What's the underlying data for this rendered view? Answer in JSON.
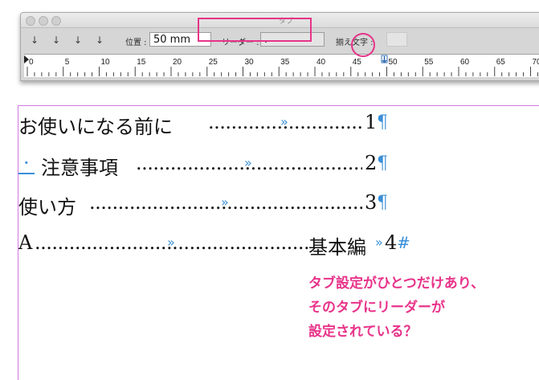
{
  "window": {
    "title": "タブ"
  },
  "toolbar": {
    "tab_types": [
      {
        "icon": "left-justified-tab-icon",
        "glyph": "↓"
      },
      {
        "icon": "center-justified-tab-icon",
        "glyph": "↓"
      },
      {
        "icon": "right-justified-tab-icon",
        "glyph": "↓"
      },
      {
        "icon": "align-to-decimal-tab-icon",
        "glyph": "↓"
      }
    ],
    "position_label": "位置 :",
    "position_value": "50 mm",
    "leader_label": "リーダー :",
    "leader_value": ".",
    "align_on_label": "揃え文字 :",
    "align_on_value": ""
  },
  "ruler": {
    "labels": [
      "0",
      "5",
      "10",
      "15",
      "20",
      "25",
      "30",
      "35",
      "40",
      "45",
      "50",
      "55",
      "60",
      "65",
      "70"
    ]
  },
  "document": {
    "lines": [
      {
        "text": "お使いになる前に",
        "number": "1",
        "end_mark": "¶"
      },
      {
        "text": "注意事項",
        "number": "2",
        "end_mark": "¶"
      },
      {
        "text": "使い方",
        "number": "3",
        "end_mark": "¶"
      },
      {
        "lead": "A",
        "text": "基本編",
        "number": "4",
        "end_mark": "#"
      }
    ],
    "tab_glyph": "»",
    "dot_leader": "............................................................................................................................................"
  },
  "annotation": {
    "lines": [
      "タブ設定がひとつだけあり、",
      "そのタブにリーダーが",
      "設定されている？"
    ]
  },
  "colors": {
    "accent": "#e8338a",
    "hidden_chars": "#3a8fd8",
    "frame_guide": "#d07adf"
  }
}
